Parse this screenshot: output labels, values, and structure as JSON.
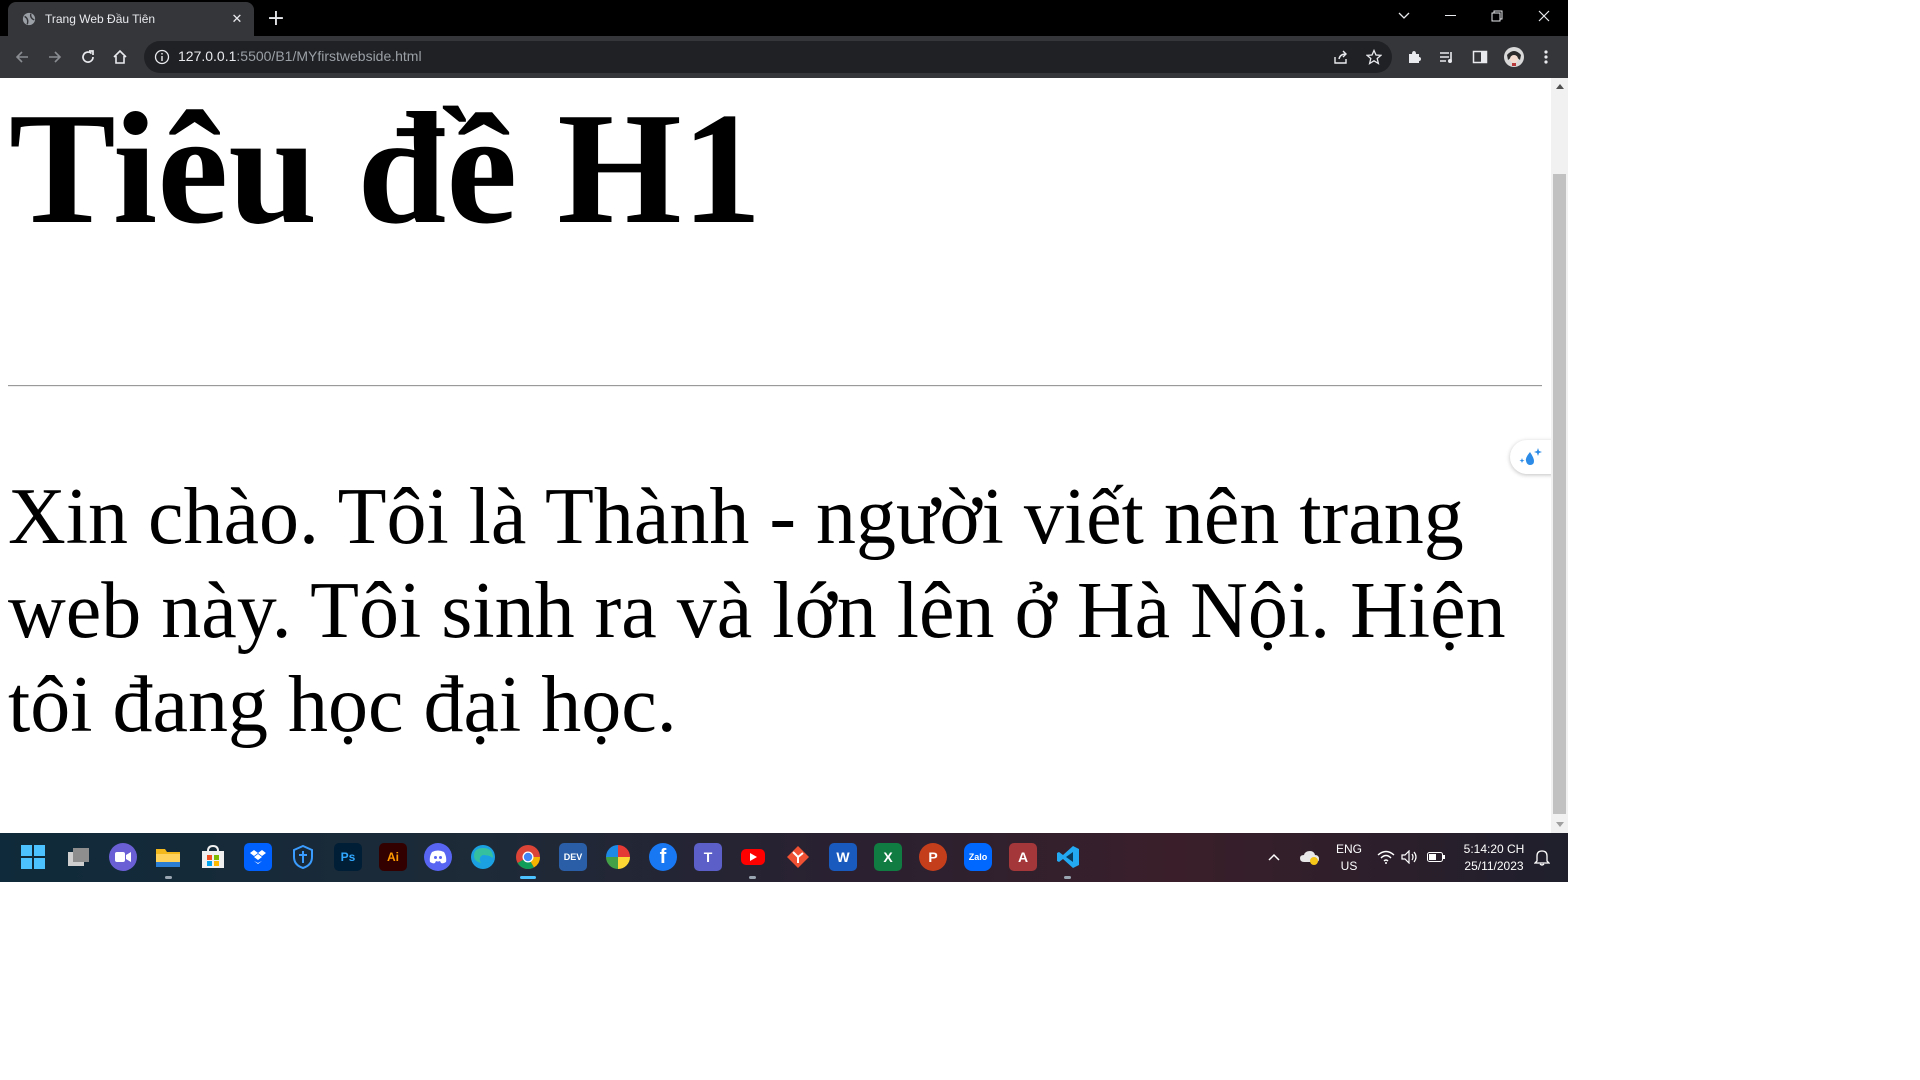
{
  "browser": {
    "tab_title": "Trang Web Đầu Tiên",
    "url_host": "127.0.0.1",
    "url_rest": ":5500/B1/MYfirstwebside.html"
  },
  "page": {
    "heading": "Tiêu đề H1",
    "paragraph": "Xin chào. Tôi là Thành - người viết nên trang web này. Tôi sinh ra và lớn lên ở Hà Nội. Hiện tôi đang học đại học."
  },
  "taskbar": {
    "apps": [
      {
        "icon": "windows-start-icon"
      },
      {
        "icon": "task-view-icon"
      },
      {
        "icon": "meet-icon"
      },
      {
        "icon": "file-explorer-icon"
      },
      {
        "icon": "microsoft-store-icon"
      },
      {
        "icon": "dropbox-icon"
      },
      {
        "icon": "security-app-icon"
      },
      {
        "icon": "photoshop-icon",
        "label": "Ps"
      },
      {
        "icon": "illustrator-icon",
        "label": "Ai"
      },
      {
        "icon": "discord-icon"
      },
      {
        "icon": "edge-icon"
      },
      {
        "icon": "chrome-icon"
      },
      {
        "icon": "dev-icon",
        "label": "DEV"
      },
      {
        "icon": "color-wheel-icon"
      },
      {
        "icon": "facebook-icon",
        "label": "f"
      },
      {
        "icon": "teams-icon",
        "label": "T"
      },
      {
        "icon": "youtube-icon"
      },
      {
        "icon": "git-icon"
      },
      {
        "icon": "word-icon",
        "label": "W"
      },
      {
        "icon": "excel-icon",
        "label": "X"
      },
      {
        "icon": "powerpoint-icon",
        "label": "P"
      },
      {
        "icon": "zalo-icon",
        "label": "Zalo"
      },
      {
        "icon": "access-icon",
        "label": "A"
      },
      {
        "icon": "vscode-icon"
      }
    ],
    "language_line1": "ENG",
    "language_line2": "US",
    "time": "5:14:20 CH",
    "date": "25/11/2023"
  },
  "colors": {
    "tab_bar": "#000000",
    "toolbar": "#35363a",
    "omnibox": "#202124",
    "page_text": "#000000"
  }
}
